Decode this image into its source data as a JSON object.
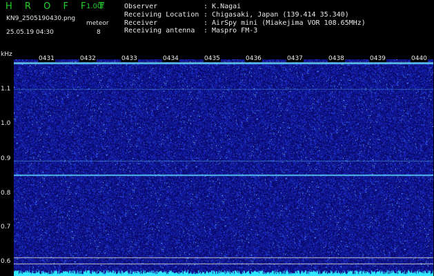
{
  "header": {
    "logo": "HROFFT",
    "version": "1.00f",
    "filename": "KN9_2505190430.png",
    "datetime": "25.05.19 04:30",
    "meteor_label": "meteor",
    "meteor_count": "8",
    "info": [
      {
        "label": "Observer",
        "value": ": K.Nagai"
      },
      {
        "label": "Receiving Location",
        "value": ": Chigasaki, Japan (139.414 35.340)"
      },
      {
        "label": "Receiver",
        "value": ": AirSpy mini (Miakejima VOR 108.65MHz)"
      },
      {
        "label": "Receiving antenna",
        "value": ": Maspro FM-3"
      }
    ]
  },
  "axes": {
    "y_unit": "kHz",
    "y_ticks": [
      "1.1",
      "1.0",
      "0.9",
      "0.8",
      "0.7",
      "0.6"
    ],
    "x_ticks": [
      "0431",
      "0432",
      "0433",
      "0434",
      "0435",
      "0436",
      "0437",
      "0438",
      "0439",
      "0440"
    ]
  },
  "colors": {
    "background": "#0a0a6e",
    "noise": "#1a2ad0",
    "carrier": "#5fd8ff",
    "guide_line": "#d8d8d8",
    "bottom_signal": "#30e8ff"
  }
}
